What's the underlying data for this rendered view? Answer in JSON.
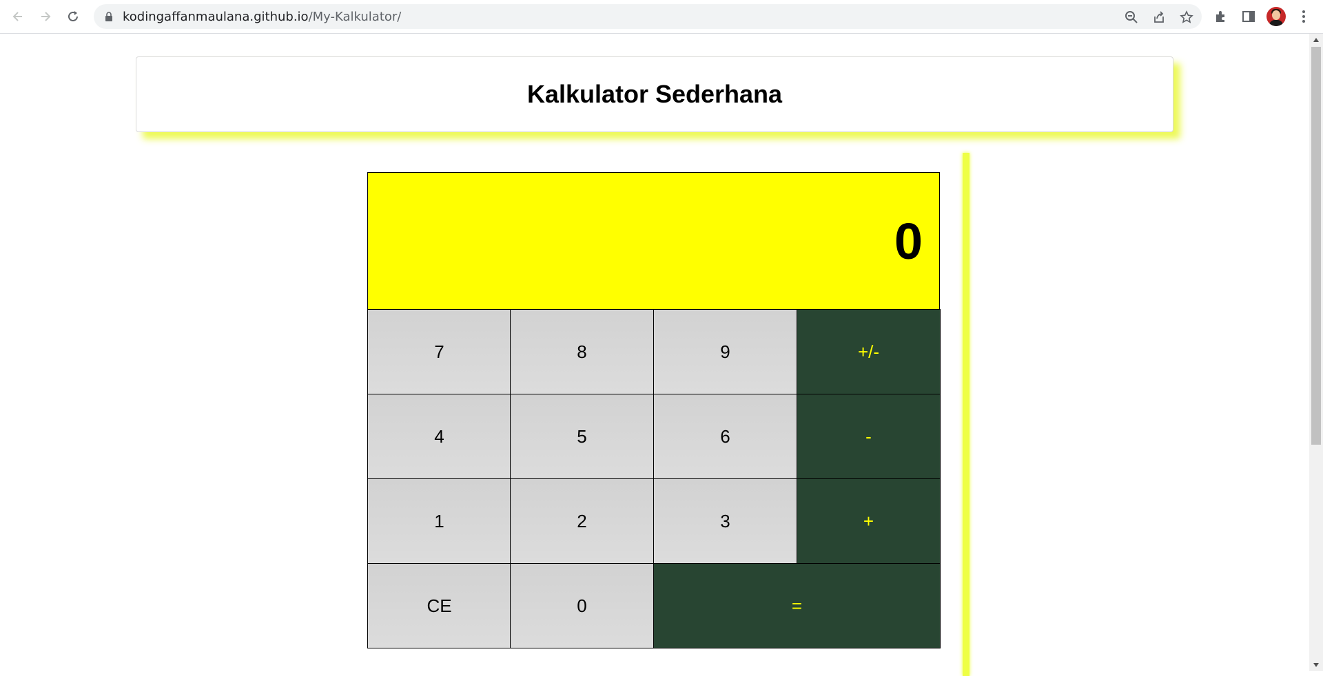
{
  "browser": {
    "url_host": "kodingaffanmaulana.github.io",
    "url_path": "/My-Kalkulator/",
    "icons": [
      "back-icon",
      "forward-icon",
      "reload-icon",
      "lock-icon",
      "zoom-out-icon",
      "share-icon",
      "bookmark-star-icon",
      "extensions-icon",
      "side-panel-icon",
      "profile-avatar",
      "menu-dots-icon"
    ]
  },
  "page": {
    "title": "Kalkulator Sederhana"
  },
  "calculator": {
    "display_value": "0",
    "keys": {
      "k7": "7",
      "k8": "8",
      "k9": "9",
      "plusminus": "+/-",
      "k4": "4",
      "k5": "5",
      "k6": "6",
      "minus": "-",
      "k1": "1",
      "k2": "2",
      "k3": "3",
      "plus": "+",
      "ce": "CE",
      "k0": "0",
      "equals": "="
    }
  },
  "colors": {
    "display_bg": "#ffff00",
    "operator_bg": "#284532",
    "operator_text": "#ffff00",
    "number_bg": "#d6d6d6",
    "shadow": "#eeff44"
  }
}
